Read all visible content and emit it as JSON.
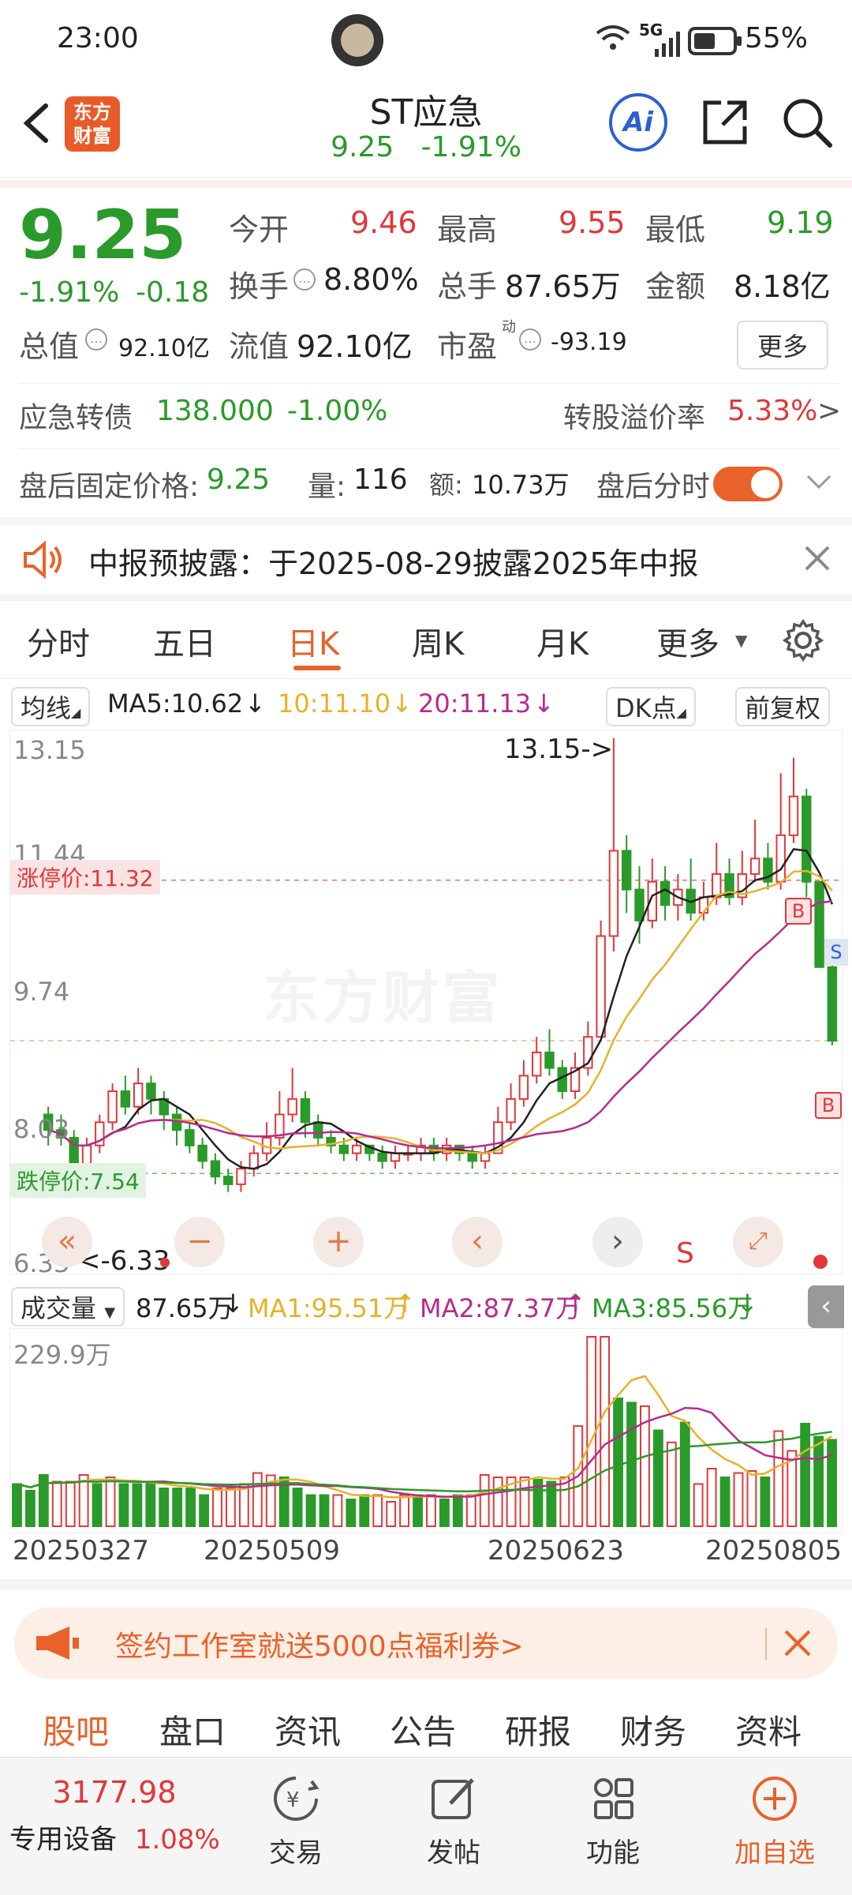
{
  "status": {
    "time": "23:00",
    "battery": "55%",
    "network": "5G"
  },
  "nav": {
    "back_icon": "chevron-left-icon",
    "logo_line1": "东方",
    "logo_line2": "财富",
    "title": "ST应急",
    "price": "9.25",
    "change_pct": "-1.91%",
    "ai_label": "Ai"
  },
  "quote": {
    "price": "9.25",
    "change_pct": "-1.91%",
    "change": "-0.18",
    "open_label": "今开",
    "open": "9.46",
    "high_label": "最高",
    "high": "9.55",
    "low_label": "最低",
    "low": "9.19",
    "turnover_label": "换手",
    "turnover": "8.80%",
    "volume_label": "总手",
    "volume": "87.65万",
    "amount_label": "金额",
    "amount": "8.18亿",
    "mcap_label": "总值",
    "mcap": "92.10亿",
    "float_label": "流值",
    "float": "92.10亿",
    "pe_label": "市盈",
    "pe_sup": "动",
    "pe": "-93.19",
    "more_button": "更多"
  },
  "bond": {
    "label": "应急转债",
    "price": "138.000",
    "change": "-1.00%",
    "premium_label": "转股溢价率",
    "premium": "5.33%"
  },
  "afterhours": {
    "price_label": "盘后固定价格:",
    "price": "9.25",
    "vol_label": "量:",
    "vol": "116",
    "amt_label": "额:",
    "amt": "10.73万",
    "timeshare_label": "盘后分时"
  },
  "notice": {
    "text": "中报预披露：于2025-08-29披露2025年中报"
  },
  "tabs": [
    "分时",
    "五日",
    "日K",
    "周K",
    "月K",
    "更多"
  ],
  "active_tab": "日K",
  "ma_bar": {
    "type": "均线",
    "ma5": "MA5:10.62",
    "ma10": "10:11.10",
    "ma20": "20:11.13",
    "dk": "DK点",
    "adjust": "前复权"
  },
  "kchart": {
    "ymax": "13.15",
    "y2": "11.44",
    "y3": "9.74",
    "y4": "8.03",
    "ymin": "6.33",
    "limit_up": "涨停价:11.32",
    "limit_down": "跌停价:7.54",
    "high_marker": "13.15->",
    "low_marker": "<-6.33",
    "watermark": "东方财富"
  },
  "vol_bar": {
    "type": "成交量",
    "vol": "87.65万",
    "ma1": "MA1:95.51万",
    "ma2": "MA2:87.37万",
    "ma3": "MA3:85.56万",
    "ymax": "229.9万"
  },
  "dates": [
    "20250327",
    "20250509",
    "20250623",
    "20250805"
  ],
  "banner": {
    "text": "签约工作室就送5000点福利券>"
  },
  "bottom_tabs": [
    "股吧",
    "盘口",
    "资讯",
    "公告",
    "研报",
    "财务",
    "资料"
  ],
  "bottom_bar": {
    "index_value": "3177.98",
    "index_name": "专用设备",
    "index_change": "1.08%",
    "trade": "交易",
    "post": "发帖",
    "func": "功能",
    "add": "加自选"
  },
  "chart_data": {
    "type": "candlestick",
    "ylim": [
      6.33,
      13.15
    ],
    "ma": {
      "MA5": 10.62,
      "MA10": 11.1,
      "MA20": 11.13
    },
    "volume_ma": {
      "MA1": "95.51万",
      "MA2": "87.37万",
      "MA3": "85.56万"
    },
    "candles": [
      [
        8.3,
        8.1,
        8.4,
        7.9
      ],
      [
        8.1,
        8.0,
        8.3,
        7.9
      ],
      [
        8.0,
        7.6,
        8.1,
        7.5
      ],
      [
        7.6,
        7.9,
        8.0,
        7.5
      ],
      [
        7.9,
        8.2,
        8.3,
        7.8
      ],
      [
        8.2,
        8.6,
        8.7,
        8.1
      ],
      [
        8.6,
        8.4,
        8.8,
        8.3
      ],
      [
        8.4,
        8.7,
        8.9,
        8.3
      ],
      [
        8.7,
        8.5,
        8.8,
        8.3
      ],
      [
        8.5,
        8.3,
        8.6,
        8.1
      ],
      [
        8.3,
        8.1,
        8.4,
        7.9
      ],
      [
        8.1,
        7.9,
        8.2,
        7.8
      ],
      [
        7.9,
        7.7,
        8.0,
        7.6
      ],
      [
        7.7,
        7.5,
        7.8,
        7.4
      ],
      [
        7.5,
        7.4,
        7.6,
        7.3
      ],
      [
        7.4,
        7.6,
        7.7,
        7.3
      ],
      [
        7.6,
        7.8,
        7.9,
        7.5
      ],
      [
        7.8,
        8.0,
        8.2,
        7.7
      ],
      [
        8.0,
        8.3,
        8.6,
        7.9
      ],
      [
        8.3,
        8.5,
        8.9,
        8.2
      ],
      [
        8.5,
        8.2,
        8.6,
        8.0
      ],
      [
        8.2,
        8.0,
        8.3,
        7.9
      ],
      [
        8.0,
        7.9,
        8.1,
        7.8
      ],
      [
        7.9,
        7.8,
        8.0,
        7.7
      ],
      [
        7.8,
        7.9,
        8.0,
        7.7
      ],
      [
        7.9,
        7.8,
        7.9,
        7.7
      ],
      [
        7.8,
        7.7,
        7.9,
        7.6
      ],
      [
        7.7,
        7.8,
        7.9,
        7.6
      ],
      [
        7.8,
        7.8,
        7.9,
        7.7
      ],
      [
        7.8,
        7.9,
        8.0,
        7.7
      ],
      [
        7.9,
        7.8,
        8.0,
        7.7
      ],
      [
        7.8,
        7.9,
        8.0,
        7.7
      ],
      [
        7.9,
        7.8,
        7.9,
        7.7
      ],
      [
        7.8,
        7.7,
        7.9,
        7.6
      ],
      [
        7.7,
        7.8,
        7.9,
        7.6
      ],
      [
        7.8,
        8.2,
        8.4,
        7.8
      ],
      [
        8.2,
        8.5,
        8.7,
        8.1
      ],
      [
        8.5,
        8.8,
        9.0,
        8.4
      ],
      [
        8.8,
        9.1,
        9.3,
        8.7
      ],
      [
        9.1,
        8.9,
        9.4,
        8.8
      ],
      [
        8.9,
        8.6,
        9.0,
        8.5
      ],
      [
        8.6,
        8.9,
        9.1,
        8.5
      ],
      [
        8.9,
        9.3,
        9.5,
        8.8
      ],
      [
        9.3,
        10.6,
        10.8,
        9.3
      ],
      [
        10.6,
        11.7,
        13.15,
        10.4
      ],
      [
        11.7,
        11.2,
        11.9,
        10.9
      ],
      [
        11.2,
        10.8,
        11.5,
        10.5
      ],
      [
        10.8,
        11.3,
        11.6,
        10.7
      ],
      [
        11.3,
        11.0,
        11.5,
        10.8
      ],
      [
        11.0,
        11.2,
        11.4,
        10.8
      ],
      [
        11.2,
        10.9,
        11.6,
        10.8
      ],
      [
        10.9,
        11.1,
        11.3,
        10.8
      ],
      [
        11.1,
        11.4,
        11.8,
        11.0
      ],
      [
        11.4,
        11.1,
        11.6,
        11.0
      ],
      [
        11.1,
        11.4,
        11.7,
        11.0
      ],
      [
        11.4,
        11.6,
        12.1,
        11.3
      ],
      [
        11.6,
        11.3,
        11.8,
        11.2
      ],
      [
        11.3,
        11.9,
        12.7,
        11.2
      ],
      [
        11.9,
        12.4,
        12.9,
        11.8
      ],
      [
        12.4,
        11.3,
        12.5,
        11.1
      ],
      [
        11.3,
        10.2,
        11.3,
        10.2
      ],
      [
        10.2,
        9.25,
        10.3,
        9.19
      ]
    ]
  }
}
